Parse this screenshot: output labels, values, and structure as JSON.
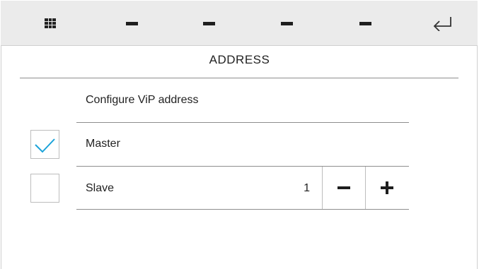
{
  "toolbar": {
    "menu_icon": "grid-icon",
    "slots": [
      "dash",
      "dash",
      "dash",
      "dash"
    ],
    "back_icon": "enter-return-icon"
  },
  "page": {
    "title": "ADDRESS",
    "section_label": "Configure ViP address"
  },
  "options": [
    {
      "label": "Master",
      "checked": true
    },
    {
      "label": "Slave",
      "checked": false,
      "value": "1"
    }
  ],
  "colors": {
    "accent": "#1aa3d9",
    "toolbar_bg": "#ebebeb",
    "rule": "#8e8e8e"
  }
}
